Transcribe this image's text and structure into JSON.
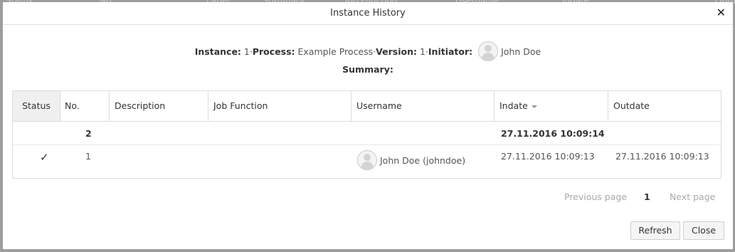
{
  "background_columns": [
    "Status",
    "No.",
    "Label",
    "Summary",
    "Job Function",
    "Username",
    "Indate",
    "Outdate"
  ],
  "dialog": {
    "title": "Instance History",
    "close_glyph": "✕"
  },
  "info": {
    "instance_label": "Instance:",
    "instance_value": "1",
    "sep1": " · ",
    "process_label": "Process:",
    "process_value": "Example Process",
    "sep2": " · ",
    "version_label": "Version:",
    "version_value": "1",
    "sep3": " · ",
    "initiator_label": "Initiator:",
    "initiator_value": "John Doe",
    "summary_label": "Summary:"
  },
  "table": {
    "columns": {
      "status": "Status",
      "no": "No.",
      "description": "Description",
      "job_function": "Job Function",
      "username": "Username",
      "indate": "Indate",
      "outdate": "Outdate"
    },
    "sort_column": "Indate",
    "rows": [
      {
        "status": "",
        "no": "2",
        "description": "",
        "job_function": "",
        "username": "",
        "indate": "27.11.2016 10:09:14",
        "outdate": ""
      },
      {
        "status": "✓",
        "no": "1",
        "description": "",
        "job_function": "",
        "username": "John Doe (johndoe)",
        "indate": "27.11.2016 10:09:13",
        "outdate": "27.11.2016 10:09:13"
      }
    ]
  },
  "pager": {
    "previous": "Previous page",
    "current": "1",
    "next": "Next page"
  },
  "buttons": {
    "refresh": "Refresh",
    "close": "Close"
  },
  "icons": {
    "avatar": "user-avatar-icon",
    "check": "checkmark-icon",
    "sort": "sort-descending-icon",
    "close": "close-icon"
  }
}
